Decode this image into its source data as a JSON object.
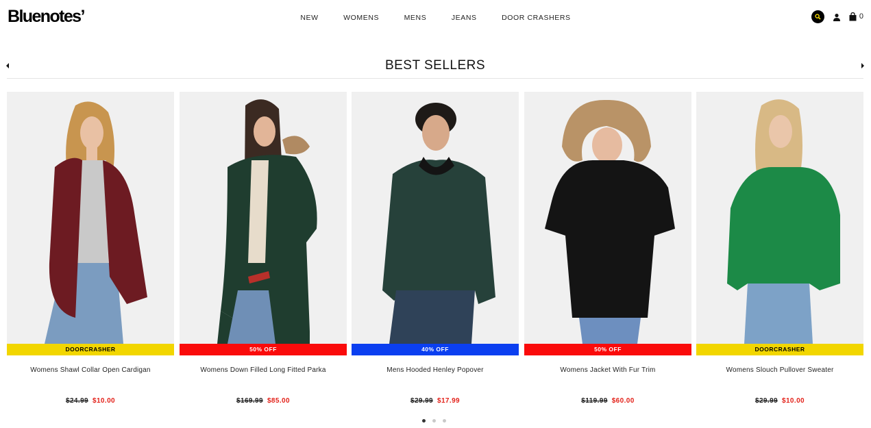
{
  "header": {
    "logo": "Bluenotes’",
    "nav": [
      "NEW",
      "WOMENS",
      "MENS",
      "JEANS",
      "DOOR CRASHERS"
    ],
    "cart_count": "0"
  },
  "section": {
    "title": "BEST SELLERS"
  },
  "products": [
    {
      "name": "Womens Shawl Collar Open Cardigan",
      "badge": "DOORCRASHER",
      "badge_color": "#f2d600",
      "badge_text_color": "#000000",
      "old_price": "$24.99",
      "new_price": "$10.00"
    },
    {
      "name": "Womens Down Filled Long Fitted Parka",
      "badge": "50% OFF",
      "badge_color": "#fa0b0b",
      "badge_text_color": "#ffffff",
      "old_price": "$169.99",
      "new_price": "$85.00"
    },
    {
      "name": "Mens Hooded Henley Popover",
      "badge": "40% OFF",
      "badge_color": "#0b3ff0",
      "badge_text_color": "#ffffff",
      "old_price": "$29.99",
      "new_price": "$17.99"
    },
    {
      "name": "Womens Jacket With Fur Trim",
      "badge": "50% OFF",
      "badge_color": "#fa0b0b",
      "badge_text_color": "#ffffff",
      "old_price": "$119.99",
      "new_price": "$60.00"
    },
    {
      "name": "Womens Slouch Pullover Sweater",
      "badge": "DOORCRASHER",
      "badge_color": "#f2d600",
      "badge_text_color": "#000000",
      "old_price": "$29.99",
      "new_price": "$10.00"
    }
  ],
  "colors": {
    "sale_price": "#e32119"
  },
  "carousel": {
    "pages": 3,
    "active_page": 1
  }
}
